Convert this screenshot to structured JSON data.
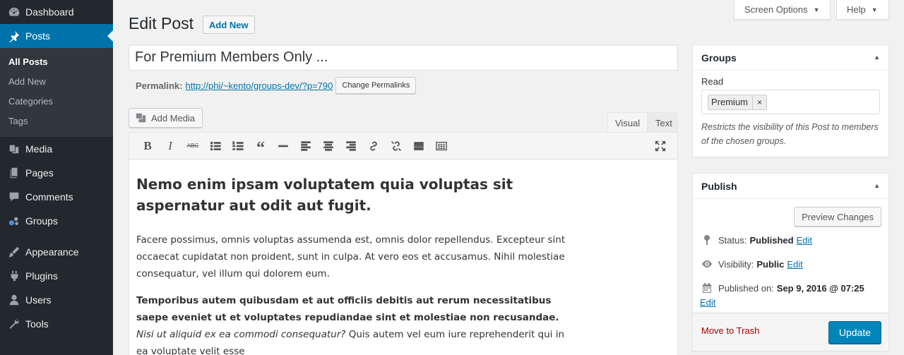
{
  "sidebar": {
    "items": [
      {
        "label": "Dashboard",
        "icon": "dashboard-icon"
      },
      {
        "label": "Posts",
        "icon": "pushpin-icon"
      },
      {
        "label": "Media",
        "icon": "media-icon"
      },
      {
        "label": "Pages",
        "icon": "pages-icon"
      },
      {
        "label": "Comments",
        "icon": "comments-icon"
      },
      {
        "label": "Groups",
        "icon": "groups-icon"
      },
      {
        "label": "Appearance",
        "icon": "appearance-icon"
      },
      {
        "label": "Plugins",
        "icon": "plugins-icon"
      },
      {
        "label": "Users",
        "icon": "users-icon"
      },
      {
        "label": "Tools",
        "icon": "tools-icon"
      }
    ],
    "posts_submenu": [
      "All Posts",
      "Add New",
      "Categories",
      "Tags"
    ]
  },
  "top": {
    "screen_options": "Screen Options",
    "help": "Help"
  },
  "heading": {
    "title": "Edit Post",
    "add_new": "Add New"
  },
  "post": {
    "title": "For Premium Members Only ...",
    "permalink_label": "Permalink:",
    "permalink_url": "http://phi/~kento/groups-dev/?p=790",
    "change_permalinks": "Change Permalinks"
  },
  "editor": {
    "add_media": "Add Media",
    "tab_visual": "Visual",
    "tab_text": "Text",
    "toolbar": [
      "bold-icon",
      "italic-icon",
      "strikethrough-icon",
      "bullet-list-icon",
      "numbered-list-icon",
      "blockquote-icon",
      "horizontal-rule-icon",
      "align-left-icon",
      "align-center-icon",
      "align-right-icon",
      "link-icon",
      "unlink-icon",
      "read-more-icon",
      "toolbar-toggle-icon",
      "fullscreen-icon"
    ],
    "heading": "Nemo enim ipsam voluptatem quia voluptas sit aspernatur aut odit aut fugit.",
    "paragraph1": "Facere possimus, omnis voluptas assumenda est, omnis dolor repellendus. Excepteur sint occaecat cupidatat non proident, sunt in culpa. At vero eos et accusamus. Nihil molestiae consequatur, vel illum qui dolorem eum.",
    "paragraph2_bold": "Temporibus autem quibusdam et aut officiis debitis aut rerum necessitatibus saepe eveniet ut et voluptates repudiandae sint et molestiae non recusandae.",
    "paragraph2_italic": "Nisi ut aliquid ex ea commodi consequatur?",
    "paragraph2_rest": "Quis autem vel eum iure reprehenderit qui in ea voluptate velit esse"
  },
  "groups_box": {
    "title": "Groups",
    "read_label": "Read",
    "selected": "Premium",
    "remove": "×",
    "description": "Restricts the visibility of this Post to members of the chosen groups."
  },
  "publish_box": {
    "title": "Publish",
    "preview": "Preview Changes",
    "status_label": "Status:",
    "status_value": "Published",
    "visibility_label": "Visibility:",
    "visibility_value": "Public",
    "published_label": "Published on:",
    "published_value": "Sep 9, 2016 @ 07:25",
    "edit": "Edit",
    "trash": "Move to Trash",
    "update": "Update"
  },
  "colors": {
    "sidebar_bg": "#23282d",
    "accent": "#0073aa",
    "primary_button": "#0085ba",
    "trash": "#a00"
  }
}
